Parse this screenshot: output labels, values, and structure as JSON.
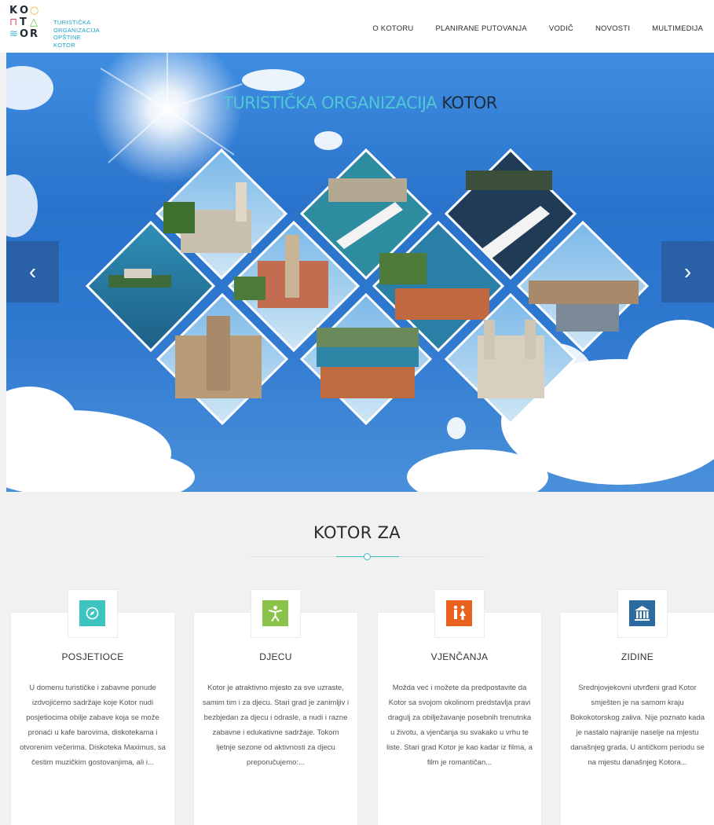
{
  "logo": {
    "letters": [
      "K",
      "O",
      "O",
      "A",
      "T",
      "A",
      "S",
      "O",
      "R"
    ],
    "line1": "TURISTIČKA",
    "line2": "ORGANIZACIJA",
    "line3": "OPŠTINE KOTOR"
  },
  "nav": {
    "items": [
      "O KOTORU",
      "PLANIRANE PUTOVANJA",
      "VODIČ",
      "NOVOSTI",
      "MULTIMEDIJA"
    ]
  },
  "hero": {
    "title_part1": "TURISTIČKA ORGANIZACIJA",
    "title_part2": "KOTOR",
    "prev_icon": "chevron-left-icon",
    "next_icon": "chevron-right-icon",
    "prev_glyph": "‹",
    "next_glyph": "›"
  },
  "section": {
    "title": "KOTOR ZA"
  },
  "cards": [
    {
      "icon": "compass-icon",
      "icon_color": "#3ec4c0",
      "title": "POSJETIOCE",
      "text": "U domenu turističke i zabavne ponude izdvojićemo sadržaje koje Kotor nudi posjetiocima obilje zabave koja se može pronaći u kafe barovima, diskotekama i otvorenim večerima. Diskoteka Maximus, sa čestim muzičkim gostovanjima, ali i..."
    },
    {
      "icon": "child-icon",
      "icon_color": "#8bc34a",
      "title": "DJECU",
      "text": "Kotor je atraktivno mjesto za sve uzraste, samim tim i za djecu. Stari grad je zanimljiv i bezbjedan za djecu i odrasle, a nudi i razne zabavne i edukativne sadržaje. Tokom ljetnje sezone od aktivnosti za djecu preporučujemo:..."
    },
    {
      "icon": "couple-icon",
      "icon_color": "#e8621e",
      "title": "VJENČANJA",
      "text": "Možda već i možete da predpostavite da Kotor sa svojom okolinom predstavlja pravi dragulj za obilježavanje posebnih trenutnka u životu, a vjenčanja su svakako u vrhu te liste. Stari grad Kotor je kao kadar iz filma, a film je romantičan..."
    },
    {
      "icon": "museum-icon",
      "icon_color": "#2c6aa0",
      "title": "ZIDINE",
      "text": "Srednjovjekovni utvrđeni grad Kotor smješten je na samom kraju Bokokotorskog zaliva. Nije poznato kada je nastalo najranije naselje na mjestu današnjeg grada. U antičkom periodu se na mjestu današnjeg Kotora..."
    }
  ]
}
